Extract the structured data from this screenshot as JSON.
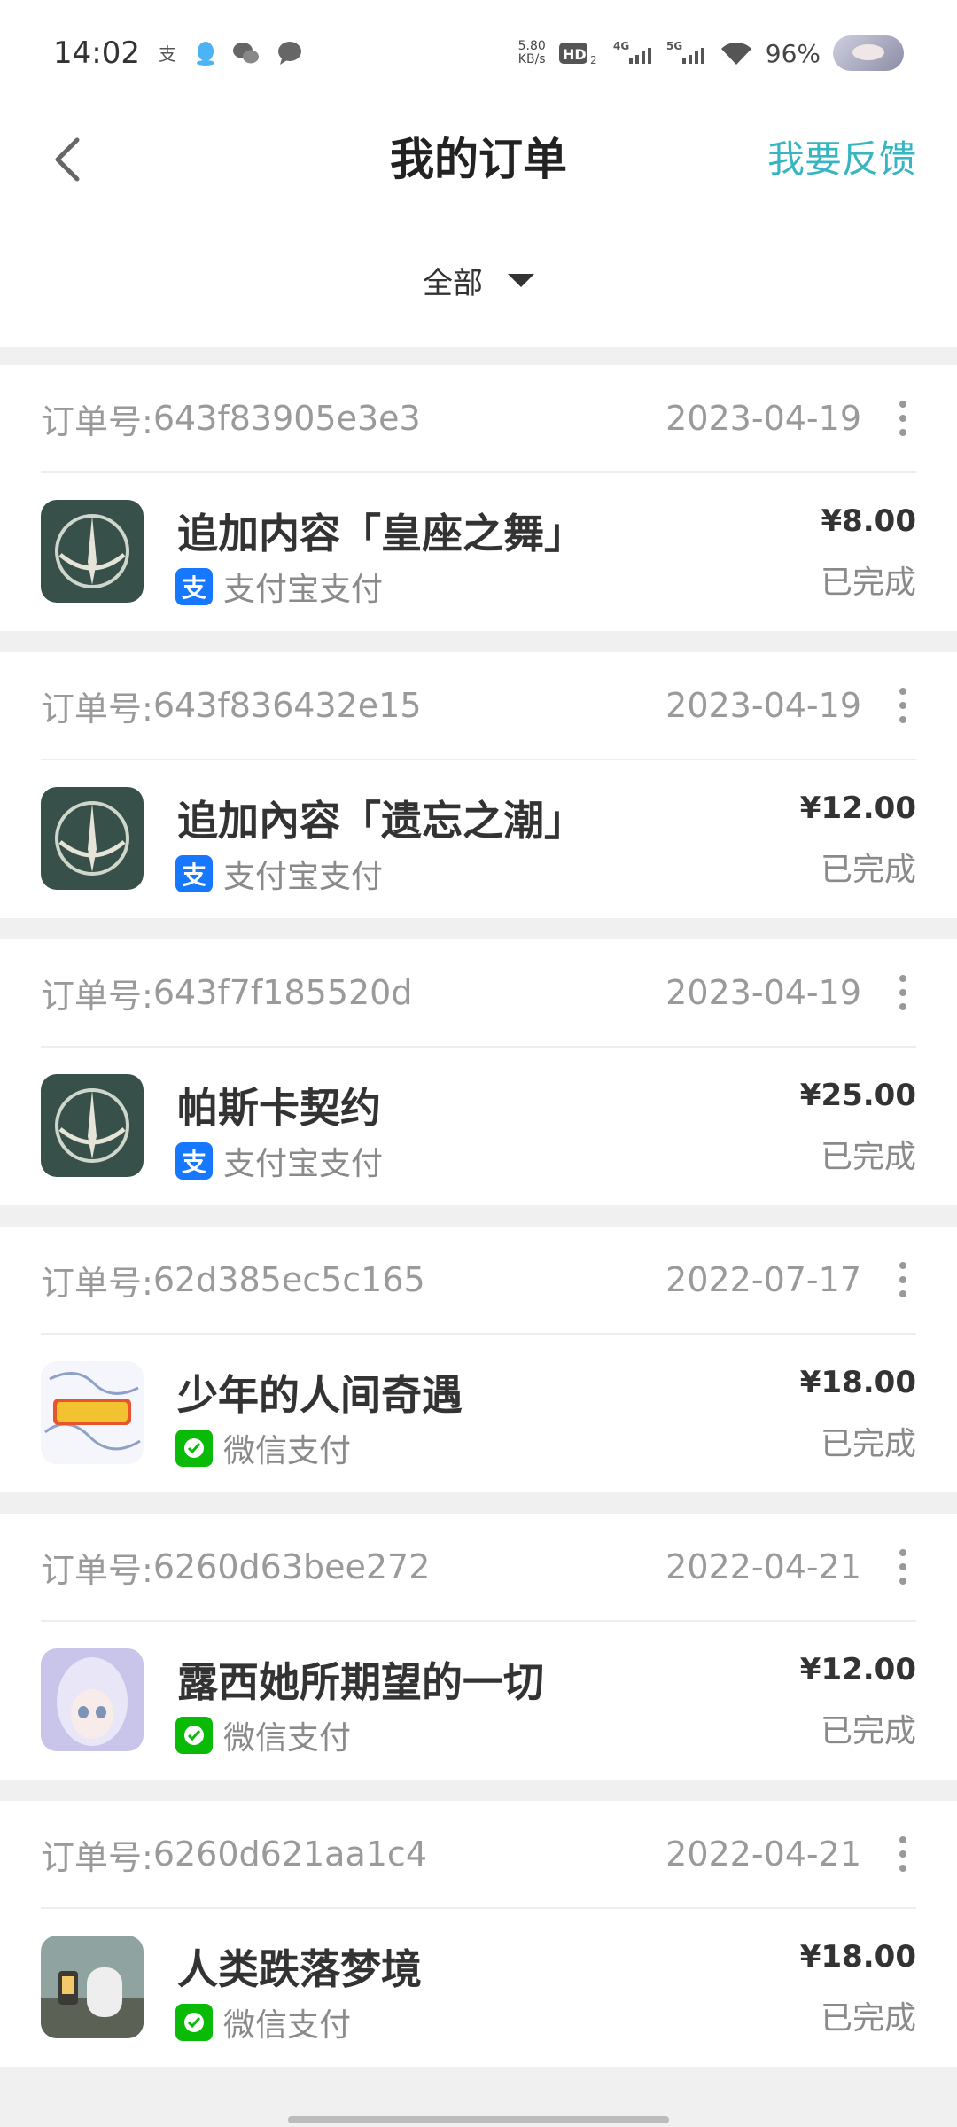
{
  "status_bar": {
    "time": "14:02",
    "netspeed_value": "5.80",
    "netspeed_unit": "KB/s",
    "hd": "HD",
    "sim1": "4G",
    "sim2": "5G",
    "battery": "96%"
  },
  "header": {
    "title": "我的订单",
    "feedback": "我要反馈"
  },
  "filter": {
    "label": "全部"
  },
  "colors": {
    "accent": "#37b6c2",
    "alipay": "#1677ff",
    "wechat": "#09bb07"
  },
  "orders": [
    {
      "order_no_label": "订单号:",
      "order_no": "643f83905e3e3",
      "date": "2023-04-19",
      "title": " 追加内容「皇座之舞」",
      "pay_method": "支付宝支付",
      "pay_icon": "alipay-icon",
      "price": "¥8.00",
      "status": "已完成",
      "app_icon": "pascal-contract-icon"
    },
    {
      "order_no_label": "订单号:",
      "order_no": "643f836432e15",
      "date": "2023-04-19",
      "title": "追加內容「遗忘之潮」",
      "pay_method": "支付宝支付",
      "pay_icon": "alipay-icon",
      "price": "¥12.00",
      "status": "已完成",
      "app_icon": "pascal-contract-icon"
    },
    {
      "order_no_label": "订单号:",
      "order_no": "643f7f185520d",
      "date": "2023-04-19",
      "title": "帕斯卡契约",
      "pay_method": "支付宝支付",
      "pay_icon": "alipay-icon",
      "price": "¥25.00",
      "status": "已完成",
      "app_icon": "pascal-contract-icon"
    },
    {
      "order_no_label": "订单号:",
      "order_no": "62d385ec5c165",
      "date": "2022-07-17",
      "title": "少年的人间奇遇",
      "pay_method": "微信支付",
      "pay_icon": "wechat-pay-icon",
      "price": "¥18.00",
      "status": "已完成",
      "app_icon": "teen-wonders-icon"
    },
    {
      "order_no_label": "订单号:",
      "order_no": "6260d63bee272",
      "date": "2022-04-21",
      "title": "露西她所期望的一切",
      "pay_method": "微信支付",
      "pay_icon": "wechat-pay-icon",
      "price": "¥12.00",
      "status": "已完成",
      "app_icon": "lucy-icon"
    },
    {
      "order_no_label": "订单号:",
      "order_no": "6260d621aa1c4",
      "date": "2022-04-21",
      "title": "人类跌落梦境",
      "pay_method": "微信支付",
      "pay_icon": "wechat-pay-icon",
      "price": "¥18.00",
      "status": "已完成",
      "app_icon": "human-fall-flat-icon"
    }
  ]
}
